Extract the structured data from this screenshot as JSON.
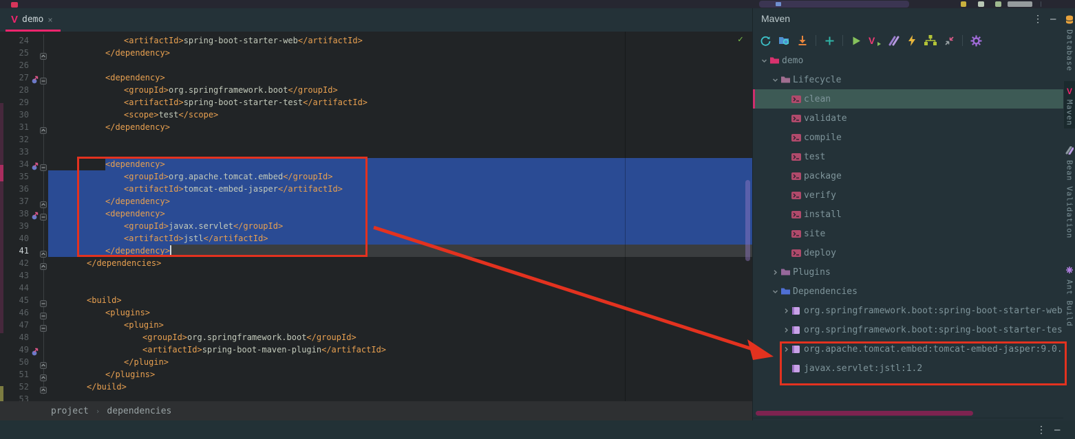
{
  "colors": {
    "accent_pink": "#f0256d",
    "annotation_red": "#e3321f",
    "selection_blue": "#2a4b94"
  },
  "tab_bar": {
    "tabs": [
      {
        "label": "demo",
        "close": "×"
      }
    ]
  },
  "editor": {
    "inspection_ok": "✓",
    "caret_line": 41,
    "lines": [
      {
        "n": 24,
        "indent": 3,
        "seg": [
          [
            "tg",
            "<artifactId>"
          ],
          [
            "tv",
            "spring-boot-starter-web"
          ],
          [
            "tg",
            "</artifactId>"
          ]
        ]
      },
      {
        "n": 25,
        "indent": 2,
        "fold": "e",
        "seg": [
          [
            "tg",
            "</dependency>"
          ]
        ]
      },
      {
        "n": 26,
        "indent": 0,
        "seg": []
      },
      {
        "n": 27,
        "indent": 2,
        "gico": true,
        "fold": "s",
        "seg": [
          [
            "tg",
            "<dependency>"
          ]
        ]
      },
      {
        "n": 28,
        "indent": 3,
        "seg": [
          [
            "tg",
            "<groupId>"
          ],
          [
            "tv",
            "org.springframework.boot"
          ],
          [
            "tg",
            "</groupId>"
          ]
        ]
      },
      {
        "n": 29,
        "indent": 3,
        "seg": [
          [
            "tg",
            "<artifactId>"
          ],
          [
            "tv",
            "spring-boot-starter-test"
          ],
          [
            "tg",
            "</artifactId>"
          ]
        ]
      },
      {
        "n": 30,
        "indent": 3,
        "seg": [
          [
            "tg",
            "<scope>"
          ],
          [
            "tv",
            "test"
          ],
          [
            "tg",
            "</scope>"
          ]
        ]
      },
      {
        "n": 31,
        "indent": 2,
        "fold": "e",
        "seg": [
          [
            "tg",
            "</dependency>"
          ]
        ]
      },
      {
        "n": 32,
        "indent": 0,
        "seg": []
      },
      {
        "n": 33,
        "indent": 0,
        "seg": []
      },
      {
        "n": 34,
        "indent": 2,
        "gico": true,
        "fold": "s",
        "sel": "text",
        "seg": [
          [
            "tg",
            "<dependency>"
          ]
        ]
      },
      {
        "n": 35,
        "indent": 3,
        "sel": "full",
        "seg": [
          [
            "tg",
            "<groupId>"
          ],
          [
            "tv",
            "org.apache.tomcat.embed"
          ],
          [
            "tg",
            "</groupId>"
          ]
        ]
      },
      {
        "n": 36,
        "indent": 3,
        "sel": "full",
        "seg": [
          [
            "tg",
            "<artifactId>"
          ],
          [
            "tv",
            "tomcat-embed-jasper"
          ],
          [
            "tg",
            "</artifactId>"
          ]
        ]
      },
      {
        "n": 37,
        "indent": 2,
        "fold": "e",
        "sel": "full",
        "seg": [
          [
            "tg",
            "</dependency>"
          ]
        ]
      },
      {
        "n": 38,
        "indent": 2,
        "gico": true,
        "fold": "s",
        "sel": "full",
        "seg": [
          [
            "tg",
            "<dependency>"
          ]
        ]
      },
      {
        "n": 39,
        "indent": 3,
        "sel": "full",
        "seg": [
          [
            "tg",
            "<groupId>"
          ],
          [
            "tv",
            "javax.servlet"
          ],
          [
            "tg",
            "</groupId>"
          ]
        ]
      },
      {
        "n": 40,
        "indent": 3,
        "sel": "full",
        "seg": [
          [
            "tg",
            "<artifactId>"
          ],
          [
            "tv",
            "jstl"
          ],
          [
            "tg",
            "</artifactId>"
          ]
        ]
      },
      {
        "n": 41,
        "indent": 2,
        "fold": "e",
        "sel": "caret",
        "seg": [
          [
            "tg",
            "</dependency>"
          ]
        ]
      },
      {
        "n": 42,
        "indent": 1,
        "fold": "e",
        "seg": [
          [
            "tg",
            "</dependencies>"
          ]
        ]
      },
      {
        "n": 43,
        "indent": 0,
        "seg": []
      },
      {
        "n": 44,
        "indent": 0,
        "seg": []
      },
      {
        "n": 45,
        "indent": 1,
        "fold": "s",
        "seg": [
          [
            "tg",
            "<build>"
          ]
        ]
      },
      {
        "n": 46,
        "indent": 2,
        "fold": "s",
        "seg": [
          [
            "tg",
            "<plugins>"
          ]
        ]
      },
      {
        "n": 47,
        "indent": 3,
        "fold": "s",
        "seg": [
          [
            "tg",
            "<plugin>"
          ]
        ]
      },
      {
        "n": 48,
        "indent": 4,
        "seg": [
          [
            "tg",
            "<groupId>"
          ],
          [
            "tv",
            "org.springframework.boot"
          ],
          [
            "tg",
            "</groupId>"
          ]
        ]
      },
      {
        "n": 49,
        "indent": 4,
        "gico": true,
        "seg": [
          [
            "tg",
            "<artifactId>"
          ],
          [
            "tv",
            "spring-boot-maven-plugin"
          ],
          [
            "tg",
            "</artifactId>"
          ]
        ]
      },
      {
        "n": 50,
        "indent": 3,
        "fold": "e",
        "seg": [
          [
            "tg",
            "</plugin>"
          ]
        ]
      },
      {
        "n": 51,
        "indent": 2,
        "fold": "e",
        "seg": [
          [
            "tg",
            "</plugins>"
          ]
        ]
      },
      {
        "n": 52,
        "indent": 1,
        "fold": "e",
        "seg": [
          [
            "tg",
            "</build>"
          ]
        ]
      },
      {
        "n": 53,
        "indent": 0,
        "seg": []
      }
    ],
    "breadcrumbs": [
      "project",
      "dependencies"
    ]
  },
  "maven_panel": {
    "title": "Maven",
    "header_icons": {
      "more": "⋮",
      "minimize": "—"
    },
    "toolbar": [
      {
        "name": "reload-all-maven-projects"
      },
      {
        "name": "generate-sources"
      },
      {
        "name": "download-sources"
      },
      {
        "name": "separator"
      },
      {
        "name": "add-maven-project"
      },
      {
        "name": "separator"
      },
      {
        "name": "run-maven-build"
      },
      {
        "name": "execute-maven-goal"
      },
      {
        "name": "toggle-offline-mode"
      },
      {
        "name": "toggle-skip-tests"
      },
      {
        "name": "show-dependencies"
      },
      {
        "name": "collapse-all"
      },
      {
        "name": "separator"
      },
      {
        "name": "maven-settings"
      }
    ],
    "tree": [
      {
        "lvl": 0,
        "chev": "v",
        "icon": "project",
        "label": "demo"
      },
      {
        "lvl": 1,
        "chev": "v",
        "icon": "folder-lifecycle",
        "label": "Lifecycle"
      },
      {
        "lvl": 2,
        "chev": null,
        "icon": "goal",
        "label": "clean",
        "selected": true
      },
      {
        "lvl": 2,
        "chev": null,
        "icon": "goal",
        "label": "validate"
      },
      {
        "lvl": 2,
        "chev": null,
        "icon": "goal",
        "label": "compile"
      },
      {
        "lvl": 2,
        "chev": null,
        "icon": "goal",
        "label": "test"
      },
      {
        "lvl": 2,
        "chev": null,
        "icon": "goal",
        "label": "package"
      },
      {
        "lvl": 2,
        "chev": null,
        "icon": "goal",
        "label": "verify"
      },
      {
        "lvl": 2,
        "chev": null,
        "icon": "goal",
        "label": "install"
      },
      {
        "lvl": 2,
        "chev": null,
        "icon": "goal",
        "label": "site"
      },
      {
        "lvl": 2,
        "chev": null,
        "icon": "goal",
        "label": "deploy"
      },
      {
        "lvl": 1,
        "chev": ">",
        "icon": "folder-plugins",
        "label": "Plugins"
      },
      {
        "lvl": 1,
        "chev": "v",
        "icon": "folder-deps",
        "label": "Dependencies"
      },
      {
        "lvl": 2,
        "chev": ">",
        "icon": "lib",
        "label": "org.springframework.boot:spring-boot-starter-web"
      },
      {
        "lvl": 2,
        "chev": ">",
        "icon": "lib",
        "label": "org.springframework.boot:spring-boot-starter-tes"
      },
      {
        "lvl": 2,
        "chev": ">",
        "icon": "lib",
        "label": "org.apache.tomcat.embed:tomcat-embed-jasper:9.0."
      },
      {
        "lvl": 2,
        "chev": null,
        "icon": "lib",
        "label": "javax.servlet:jstl:1.2"
      }
    ]
  },
  "right_stripe": {
    "items": [
      {
        "label": "Database",
        "icon": "database-icon"
      },
      {
        "label": "Maven",
        "icon": "maven-v-icon",
        "active": true
      },
      {
        "label": "Bean Validation",
        "icon": "bean-validation-icon"
      },
      {
        "label": "Ant Build",
        "icon": "ant-build-icon"
      }
    ]
  },
  "bottom_bar": {
    "more": "⋮",
    "minimize": "—"
  }
}
